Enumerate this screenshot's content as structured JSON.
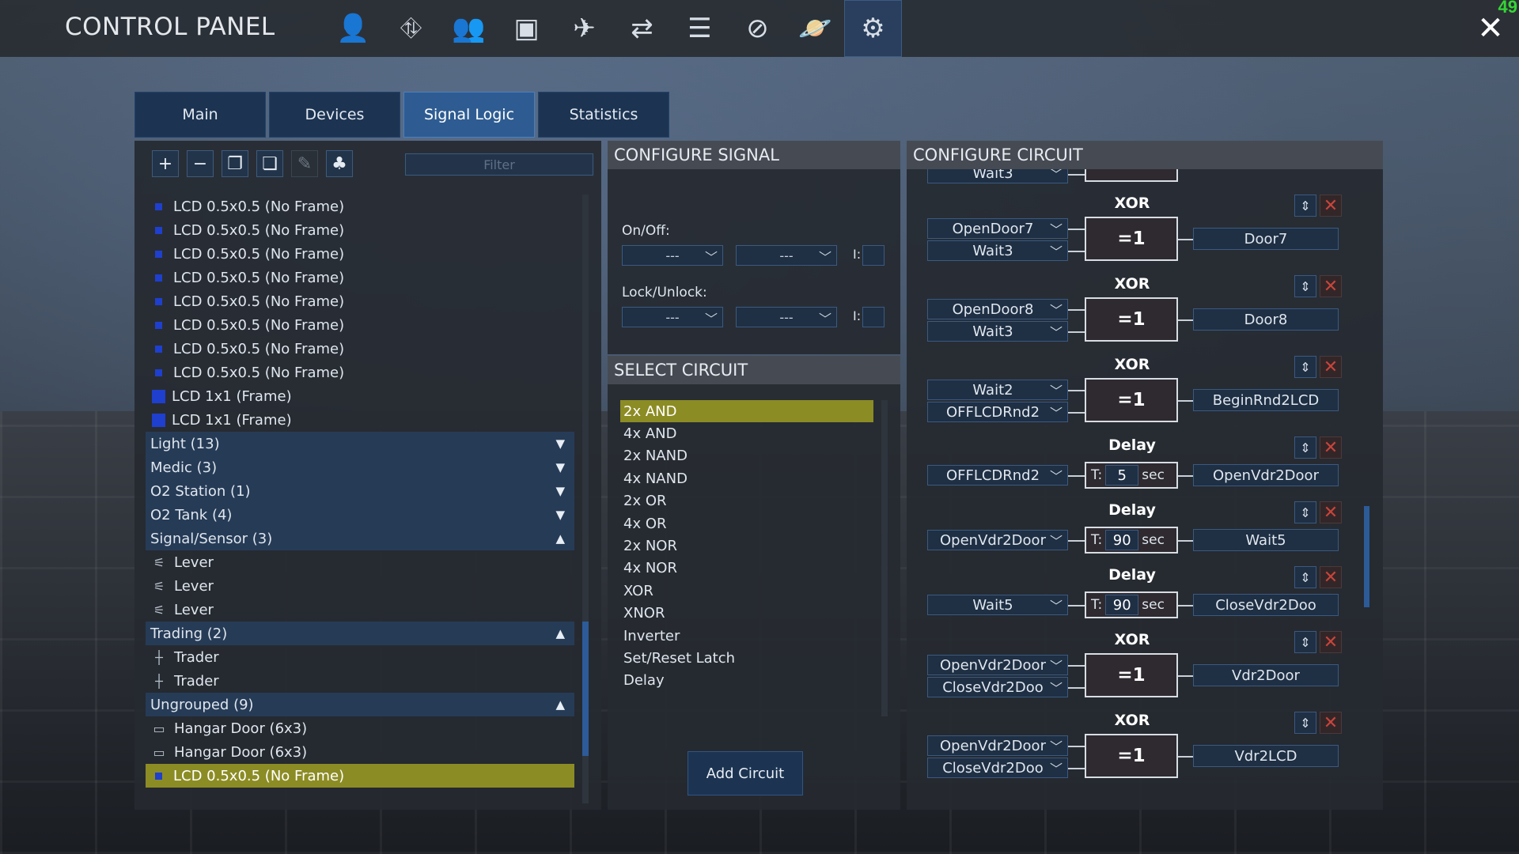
{
  "app": {
    "title": "CONTROL PANEL",
    "fps": "49",
    "close_glyph": "✕"
  },
  "nav_icons": [
    {
      "name": "player-icon",
      "glyph": "👤"
    },
    {
      "name": "network-icon",
      "glyph": "⛗"
    },
    {
      "name": "faction-icon",
      "glyph": "👥"
    },
    {
      "name": "inventory-icon",
      "glyph": "▣"
    },
    {
      "name": "ship-icon",
      "glyph": "✈"
    },
    {
      "name": "trade-icon",
      "glyph": "⇄"
    },
    {
      "name": "list-icon",
      "glyph": "☰"
    },
    {
      "name": "navigation-icon",
      "glyph": "⊘"
    },
    {
      "name": "planet-icon",
      "glyph": "🪐"
    },
    {
      "name": "control-panel-icon",
      "glyph": "⚙"
    }
  ],
  "tabs": [
    "Main",
    "Devices",
    "Signal Logic",
    "Statistics"
  ],
  "active_tab": "Signal Logic",
  "toolbar": {
    "add": "+",
    "remove": "−",
    "copy": "❐",
    "paste": "❏",
    "edit": "✎",
    "group": "♣",
    "filter_placeholder": "Filter"
  },
  "tree": [
    {
      "type": "item",
      "icon": "lcd-small",
      "label": "LCD 0.5x0.5 (No Frame)"
    },
    {
      "type": "item",
      "icon": "lcd-small",
      "label": "LCD 0.5x0.5 (No Frame)"
    },
    {
      "type": "item",
      "icon": "lcd-small",
      "label": "LCD 0.5x0.5 (No Frame)"
    },
    {
      "type": "item",
      "icon": "lcd-small",
      "label": "LCD 0.5x0.5 (No Frame)"
    },
    {
      "type": "item",
      "icon": "lcd-small",
      "label": "LCD 0.5x0.5 (No Frame)"
    },
    {
      "type": "item",
      "icon": "lcd-small",
      "label": "LCD 0.5x0.5 (No Frame)"
    },
    {
      "type": "item",
      "icon": "lcd-small",
      "label": "LCD 0.5x0.5 (No Frame)"
    },
    {
      "type": "item",
      "icon": "lcd-small",
      "label": "LCD 0.5x0.5 (No Frame)"
    },
    {
      "type": "item",
      "icon": "lcd-big",
      "label": "LCD 1x1 (Frame)"
    },
    {
      "type": "item",
      "icon": "lcd-big",
      "label": "LCD 1x1 (Frame)"
    },
    {
      "type": "group",
      "label": "Light (13)",
      "arrow": "▼"
    },
    {
      "type": "group",
      "label": "Medic (3)",
      "arrow": "▼"
    },
    {
      "type": "group",
      "label": "O2 Station (1)",
      "arrow": "▼"
    },
    {
      "type": "group",
      "label": "O2 Tank (4)",
      "arrow": "▼"
    },
    {
      "type": "group",
      "label": "Signal/Sensor (3)",
      "arrow": "▲"
    },
    {
      "type": "item",
      "icon": "lever",
      "glyph": "⚟",
      "label": "Lever"
    },
    {
      "type": "item",
      "icon": "lever",
      "glyph": "⚟",
      "label": "Lever"
    },
    {
      "type": "item",
      "icon": "lever",
      "glyph": "⚟",
      "label": "Lever"
    },
    {
      "type": "group",
      "label": "Trading (2)",
      "arrow": "▲"
    },
    {
      "type": "item",
      "icon": "trader",
      "glyph": "┼",
      "label": "Trader"
    },
    {
      "type": "item",
      "icon": "trader",
      "glyph": "┼",
      "label": "Trader"
    },
    {
      "type": "group",
      "label": "Ungrouped (9)",
      "arrow": "▲"
    },
    {
      "type": "item",
      "icon": "hangar",
      "glyph": "▭",
      "label": "Hangar Door (6x3)"
    },
    {
      "type": "item",
      "icon": "hangar",
      "glyph": "▭",
      "label": "Hangar Door (6x3)"
    },
    {
      "type": "item",
      "icon": "lcd-small",
      "label": "LCD 0.5x0.5 (No Frame)",
      "selected": true
    }
  ],
  "configure_signal": {
    "header": "CONFIGURE SIGNAL",
    "on_off_label": "On/Off:",
    "lock_label": "Lock/Unlock:",
    "dd_value": "---",
    "i_label": "I:",
    "chev": "﹀"
  },
  "select_circuit": {
    "header": "SELECT CIRCUIT",
    "items": [
      "2x AND",
      "4x AND",
      "2x NAND",
      "4x NAND",
      "2x OR",
      "4x OR",
      "2x NOR",
      "4x NOR",
      "XOR",
      "XNOR",
      "Inverter",
      "Set/Reset Latch",
      "Delay"
    ],
    "selected": "2x AND",
    "add_button": "Add Circuit"
  },
  "configure_circuit": {
    "header": "CONFIGURE CIRCUIT",
    "gate_symbol": "=1",
    "t_label": "T:",
    "sec_label": "sec",
    "up_glyph": "︿﹀",
    "x_glyph": "✕",
    "chev": "﹀",
    "partial_top": {
      "input": "Wait3"
    },
    "circuits": [
      {
        "type": "XOR",
        "inputs": [
          "OpenDoor7",
          "Wait3"
        ],
        "output": "Door7"
      },
      {
        "type": "XOR",
        "inputs": [
          "OpenDoor8",
          "Wait3"
        ],
        "output": "Door8"
      },
      {
        "type": "XOR",
        "inputs": [
          "Wait2",
          "OFFLCDRnd2"
        ],
        "output": "BeginRnd2LCD"
      },
      {
        "type": "Delay",
        "inputs": [
          "OFFLCDRnd2"
        ],
        "t": "5",
        "output": "OpenVdr2Door"
      },
      {
        "type": "Delay",
        "inputs": [
          "OpenVdr2Door"
        ],
        "t": "90",
        "output": "Wait5"
      },
      {
        "type": "Delay",
        "inputs": [
          "Wait5"
        ],
        "t": "90",
        "output": "CloseVdr2Doo"
      },
      {
        "type": "XOR",
        "inputs": [
          "OpenVdr2Door",
          "CloseVdr2Doo"
        ],
        "output": "Vdr2Door"
      },
      {
        "type": "XOR",
        "inputs": [
          "OpenVdr2Door",
          "CloseVdr2Doo"
        ],
        "output": "Vdr2LCD"
      }
    ]
  }
}
